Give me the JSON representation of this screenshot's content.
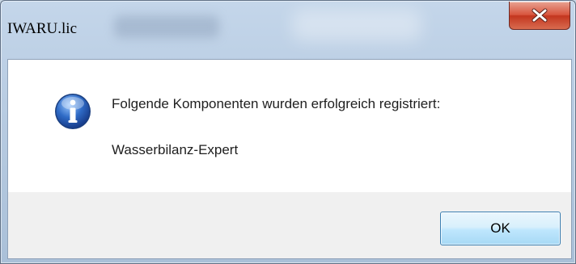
{
  "window": {
    "title": "IWARU.lic",
    "close_icon": "close-icon"
  },
  "dialog": {
    "icon": "info-icon",
    "message": "Folgende Komponenten wurden erfolgreich registriert:",
    "component": "Wasserbilanz-Expert"
  },
  "buttons": {
    "ok_label": "OK"
  },
  "colors": {
    "close_red": "#c3361f",
    "info_blue": "#2f6bc6",
    "button_border": "#3c7fb1"
  }
}
